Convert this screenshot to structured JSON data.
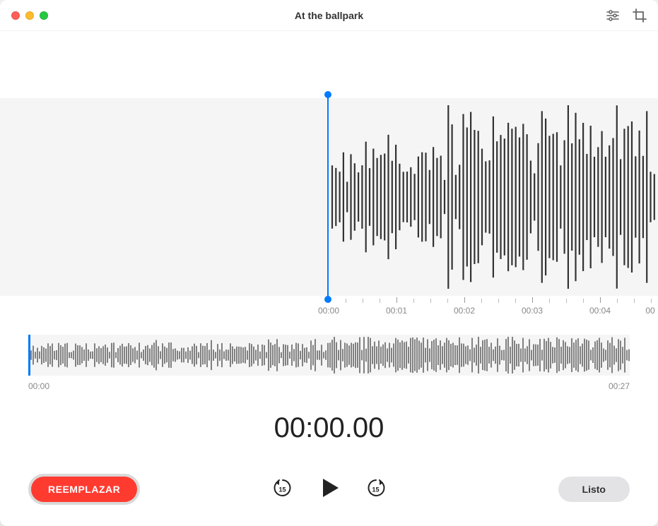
{
  "window": {
    "title": "At the ballpark"
  },
  "mainWaveform": {
    "ticks": [
      "00:00",
      "00:01",
      "00:02",
      "00:03",
      "00:04"
    ],
    "partialTick": "00"
  },
  "overview": {
    "start": "00:00",
    "end": "00:27"
  },
  "time": {
    "current": "00:00.00"
  },
  "controls": {
    "replace": "REEMPLAZAR",
    "skipSeconds": "15",
    "done": "Listo"
  },
  "icons": {
    "settings": "settings-sliders-icon",
    "crop": "crop-icon",
    "skipBack": "skip-back-15-icon",
    "play": "play-icon",
    "skipFwd": "skip-forward-15-icon"
  }
}
